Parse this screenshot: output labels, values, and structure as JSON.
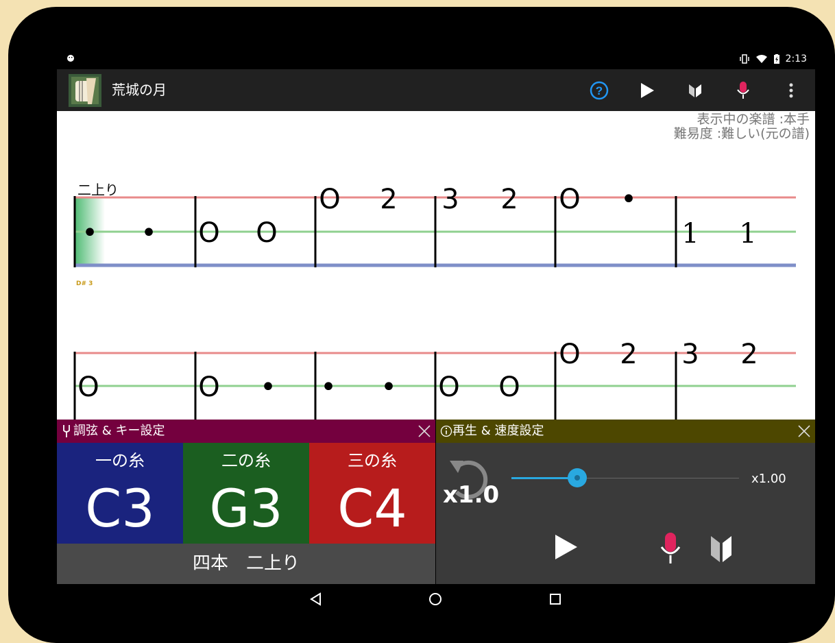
{
  "status": {
    "time": "2:13"
  },
  "appbar": {
    "title": "荒城の月"
  },
  "sheet": {
    "info_line1": "表示中の楽譜 :本手",
    "info_line2": "難易度 :難しい(元の譜)",
    "tuning_label": "二上り",
    "key_marker": "D# 3",
    "row1": [
      "•",
      "•",
      "O",
      "O",
      "O",
      "2",
      "3",
      "2",
      "O",
      "•",
      "1",
      "1"
    ],
    "row2": [
      "O",
      "O",
      "•",
      "•",
      "•",
      "O",
      "O",
      "O",
      "2",
      "3",
      "2"
    ]
  },
  "tuning_panel": {
    "title": "調弦 & キー設定",
    "strings": [
      {
        "name": "一の糸",
        "note": "C3",
        "color": "#1a237e"
      },
      {
        "name": "二の糸",
        "note": "G3",
        "color": "#1b5e20"
      },
      {
        "name": "三の糸",
        "note": "C4",
        "color": "#b71c1c"
      }
    ],
    "tuning_text": "四本　二上り"
  },
  "playback_panel": {
    "title": "再生 & 速度設定",
    "speed_badge": "x1.0",
    "speed_value": "x1.00",
    "speed_fraction": 0.28
  },
  "colors": {
    "line_top": "#e88a8a",
    "line_mid": "#8fd08f",
    "line_bottom": "#7f8fc8",
    "accent_blue": "#2196f3",
    "mic_red": "#e0245e"
  },
  "icons": [
    "android-icon",
    "vibrate-icon",
    "wifi-icon",
    "battery-icon",
    "help-icon",
    "play-icon",
    "beginner-icon",
    "mic-icon",
    "overflow-menu-icon",
    "tuning-fork-icon",
    "info-icon",
    "reset-icon",
    "back-icon",
    "home-icon",
    "recents-icon"
  ]
}
